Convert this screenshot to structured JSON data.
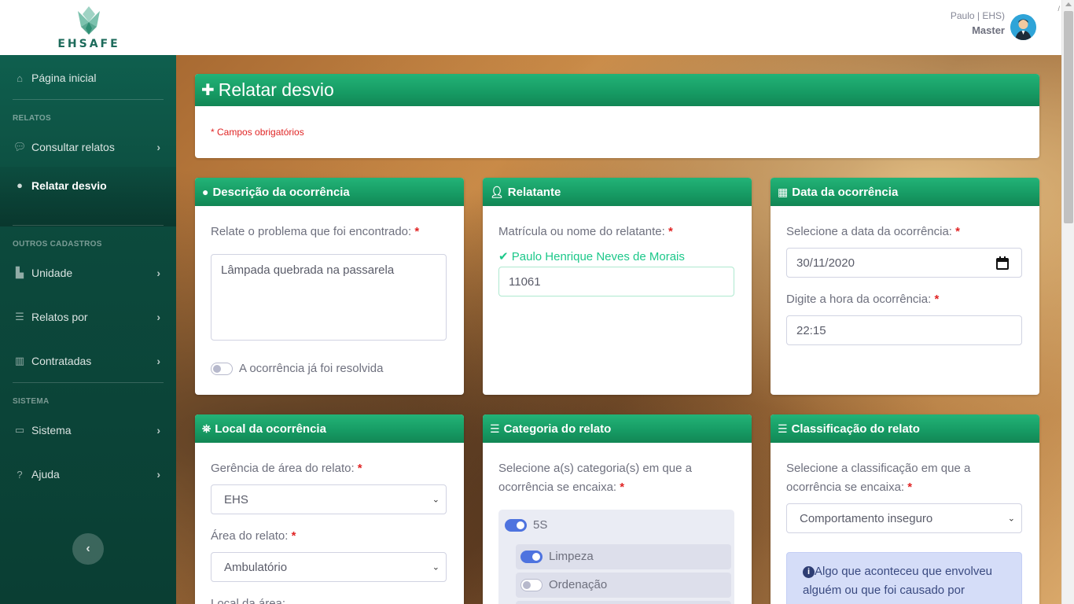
{
  "header": {
    "logo_text": "EHSAFE",
    "user_name": "Paulo | EHS)",
    "user_role": "Master",
    "corner_mark": "/"
  },
  "sidebar": {
    "home": {
      "label": "Página inicial",
      "icon": "home-icon"
    },
    "section_relatos": "RELATOS",
    "consultar": {
      "label": "Consultar relatos",
      "icon": "comments-icon"
    },
    "relatar": {
      "label": "Relatar desvio",
      "icon": "comment-dots-icon"
    },
    "section_outros": "OUTROS CADASTROS",
    "unidade": {
      "label": "Unidade",
      "icon": "industry-icon"
    },
    "relatos_por": {
      "label": "Relatos por",
      "icon": "list-icon"
    },
    "contratadas": {
      "label": "Contratadas",
      "icon": "building-icon"
    },
    "section_sistema": "SISTEMA",
    "sistema": {
      "label": "Sistema",
      "icon": "laptop-icon"
    },
    "ajuda": {
      "label": "Ajuda",
      "icon": "question-icon"
    },
    "chevron": "›",
    "collapse": "‹"
  },
  "page": {
    "title": "Relatar desvio",
    "required_note": "* Campos obrigatórios"
  },
  "descricao": {
    "title": "Descrição da ocorrência",
    "label": "Relate o problema que foi encontrado:",
    "value": "Lâmpada quebrada na passarela",
    "resolved_label": "A ocorrência já foi resolvida"
  },
  "relatante": {
    "title": "Relatante",
    "label": "Matrícula ou nome do relatante:",
    "valid_name": "Paulo Henrique Neves de Morais",
    "value": "11061"
  },
  "data": {
    "title": "Data da ocorrência",
    "date_label": "Selecione a data da ocorrência:",
    "date_value": "30/11/2020",
    "time_label": "Digite a hora da ocorrência:",
    "time_value": "22:15"
  },
  "local": {
    "title": "Local da ocorrência",
    "gerencia_label": "Gerência de área do relato:",
    "gerencia_value": "EHS",
    "area_label": "Área do relato:",
    "area_value": "Ambulatório",
    "local_label": "Local da área:"
  },
  "categoria": {
    "title": "Categoria do relato",
    "label": "Selecione a(s) categoria(s) em que a ocorrência se encaixa:",
    "items": [
      {
        "label": "5S",
        "on": true
      },
      {
        "label": "Limpeza",
        "on": true
      },
      {
        "label": "Ordenação",
        "on": false
      }
    ]
  },
  "classificacao": {
    "title": "Classificação do relato",
    "label": "Selecione a classificação em que a ocorrência se encaixa:",
    "value": "Comportamento inseguro",
    "info": "Algo que aconteceu que envolveu alguém ou que foi causado por"
  },
  "colors": {
    "accent_green": "#169a63",
    "sidebar_dark": "#0c4a3d",
    "switch_on": "#4e73df",
    "required": "#e02424"
  }
}
